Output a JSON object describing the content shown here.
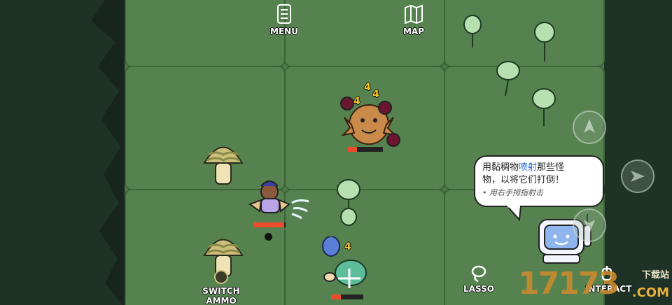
{
  "hud": {
    "menu_label": "MENU",
    "map_label": "MAP",
    "switch_ammo_label": "SWITCH AMMO",
    "lasso_label": "LASSO",
    "interact_label": "INTERACT"
  },
  "tutorial": {
    "line1_a": "用黏稠物",
    "line1_highlight": "喷射",
    "line1_b": "那些怪",
    "line2": "物，以将它们打倒！",
    "hint": "• 用右手拇指射击"
  },
  "combat": {
    "damage_top_1": "4",
    "damage_top_2": "4",
    "damage_top_3": "4",
    "damage_bottom": "4",
    "enemy_top_health": 0.25,
    "player_health": 0.95,
    "enemy_bottom_health": 0.3
  },
  "watermark": {
    "site_number": "17173",
    "site_cn": "下载站",
    "site_com": ".COM"
  },
  "colors": {
    "grass": "#55824f",
    "highlight": "#2b6bd6",
    "health": "#ee4b2b",
    "damage": "#f2c12e"
  }
}
